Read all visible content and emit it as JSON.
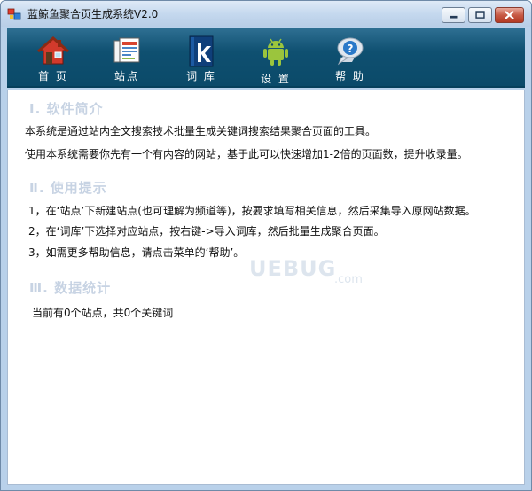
{
  "window": {
    "title": "蓝鲸鱼聚合页生成系统V2.0"
  },
  "toolbar": {
    "items": [
      {
        "label": "首 页",
        "icon": "home-icon"
      },
      {
        "label": "站点",
        "icon": "sites-icon"
      },
      {
        "label": "词 库",
        "icon": "lexicon-icon"
      },
      {
        "label": "设 置",
        "icon": "android-settings-icon"
      },
      {
        "label": "帮 助",
        "icon": "help-icon"
      }
    ]
  },
  "content": {
    "section1": {
      "title": "Ⅰ. 软件简介",
      "lines": [
        "本系统是通过站内全文搜索技术批量生成关键词搜索结果聚合页面的工具。",
        "使用本系统需要你先有一个有内容的网站，基于此可以快速增加1-2倍的页面数，提升收录量。"
      ]
    },
    "section2": {
      "title": "Ⅱ. 使用提示",
      "lines": [
        "1，在‘站点’下新建站点(也可理解为频道等)，按要求填写相关信息，然后采集导入原网站数据。",
        "2，在‘词库’下选择对应站点，按右键->导入词库，然后批量生成聚合页面。",
        "3，如需更多帮助信息，请点击菜单的‘帮助’。"
      ]
    },
    "section3": {
      "title": "Ⅲ. 数据统计",
      "summary": "当前有0个站点，共0个关键词"
    },
    "watermark": "UEBUG.com"
  },
  "colors": {
    "toolbar_bg": "#0f5071",
    "section_title": "#c7d3e3",
    "window_frame": "#b9d1ea"
  }
}
